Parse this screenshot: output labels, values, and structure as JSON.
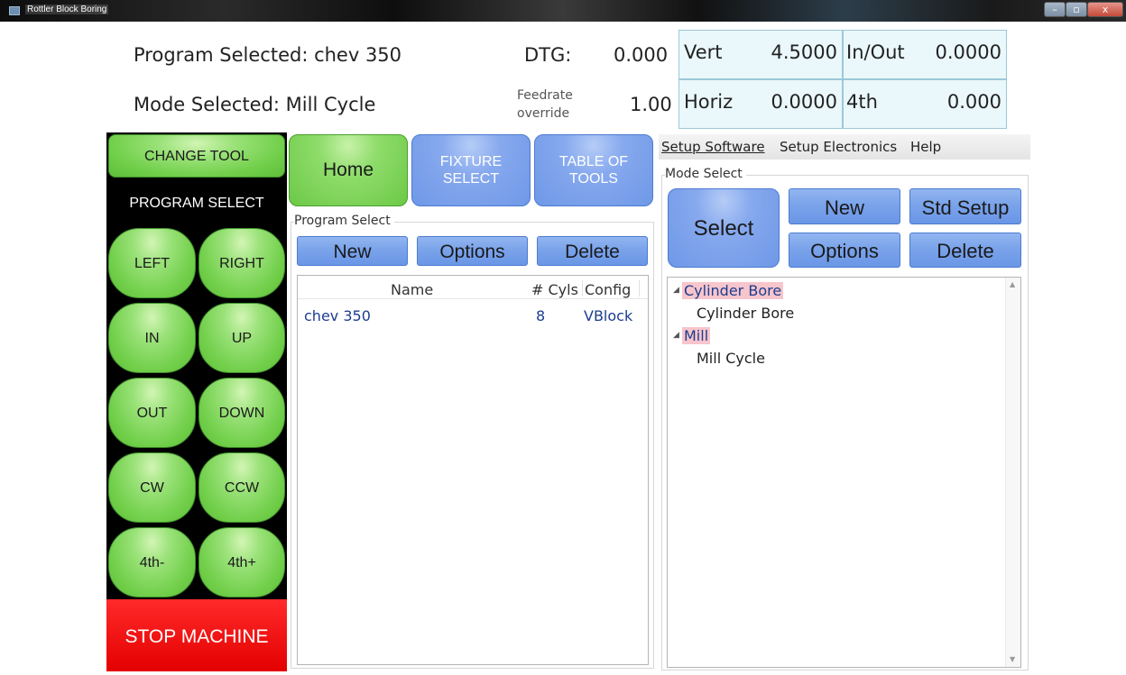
{
  "window": {
    "title": "Rottler Block Boring",
    "min_glyph": "–",
    "max_glyph": "▫",
    "close_glyph": "x"
  },
  "header": {
    "program_label": "Program Selected: chev 350",
    "mode_label": "Mode Selected: Mill Cycle",
    "dtg_label": "DTG:",
    "dtg_value": "0.000",
    "feedrate_label_1": "Feedrate",
    "feedrate_label_2": "override",
    "feedrate_value": "1.00"
  },
  "axes": {
    "vert": {
      "label": "Vert",
      "value": "4.5000"
    },
    "inout": {
      "label": "In/Out",
      "value": "0.0000"
    },
    "horiz": {
      "label": "Horiz",
      "value": "0.0000"
    },
    "fourth": {
      "label": "4th",
      "value": "0.000"
    }
  },
  "left_panel": {
    "change_tool": "CHANGE TOOL",
    "program_select": "PROGRAM SELECT",
    "jog": [
      "LEFT",
      "RIGHT",
      "IN",
      "UP",
      "OUT",
      "DOWN",
      "CW",
      "CCW",
      "4th-",
      "4th+"
    ],
    "stop": "STOP MACHINE"
  },
  "tabs": {
    "home": "Home",
    "fixture_1": "FIXTURE",
    "fixture_2": "SELECT",
    "tools_1": "TABLE OF",
    "tools_2": "TOOLS"
  },
  "program_select": {
    "group_label": "Program Select",
    "new": "New",
    "options": "Options",
    "delete": "Delete",
    "columns": {
      "name": "Name",
      "cyls": "# Cyls",
      "config": "Config"
    },
    "rows": [
      {
        "name": "chev 350",
        "cyls": "8",
        "config": "VBlock"
      }
    ]
  },
  "menu": {
    "setup_software": "Setup Software",
    "setup_electronics": "Setup Electronics",
    "help": "Help"
  },
  "mode_select": {
    "group_label": "Mode Select",
    "select": "Select",
    "new": "New",
    "std_setup": "Std Setup",
    "options": "Options",
    "delete": "Delete",
    "tree": [
      {
        "category": "Cylinder Bore",
        "child": "Cylinder Bore"
      },
      {
        "category": "Mill",
        "child": "Mill Cycle"
      }
    ]
  },
  "colors": {
    "green": "#71cf4a",
    "blue": "#7aa3ea",
    "stop_red": "#e40000",
    "tree_highlight": "#f7c5cc",
    "axis_bg": "#eaf7fb"
  }
}
